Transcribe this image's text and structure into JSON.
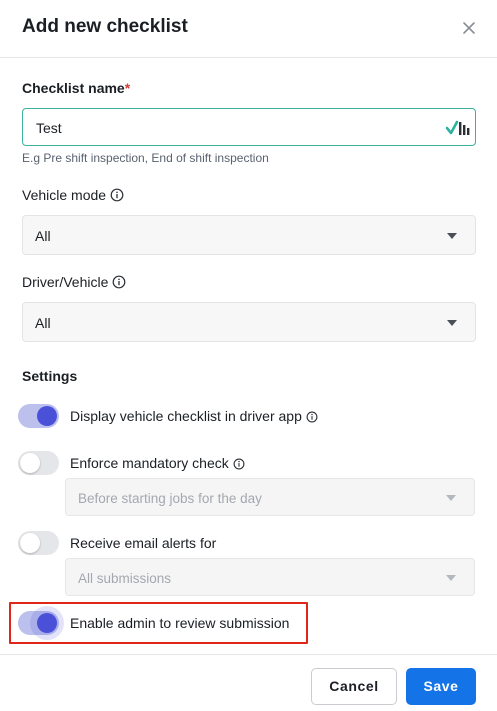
{
  "dialog": {
    "title": "Add new checklist"
  },
  "checklist_name": {
    "label": "Checklist name",
    "required_mark": "*",
    "value": "Test",
    "hint": "E.g Pre shift inspection, End of shift inspection"
  },
  "vehicle_mode": {
    "label": "Vehicle mode",
    "selected": "All"
  },
  "driver_vehicle": {
    "label": "Driver/Vehicle",
    "selected": "All"
  },
  "settings": {
    "heading": "Settings",
    "items": [
      {
        "label": "Display vehicle checklist in driver app",
        "enabled": true,
        "has_info": true
      },
      {
        "label": "Enforce mandatory check",
        "enabled": false,
        "has_info": true,
        "sub_select": "Before starting jobs for the day"
      },
      {
        "label": "Receive email alerts for",
        "enabled": false,
        "has_info": false,
        "sub_select": "All submissions"
      },
      {
        "label": "Enable admin to review submission",
        "enabled": true,
        "has_info": false
      }
    ]
  },
  "footer": {
    "cancel_label": "Cancel",
    "save_label": "Save"
  },
  "colors": {
    "accent_blue": "#1473e6",
    "toggle_on": "#4a51d8",
    "input_border": "#3bb3a0",
    "highlight_red": "#e0261a",
    "required_red": "#d93a3a"
  }
}
